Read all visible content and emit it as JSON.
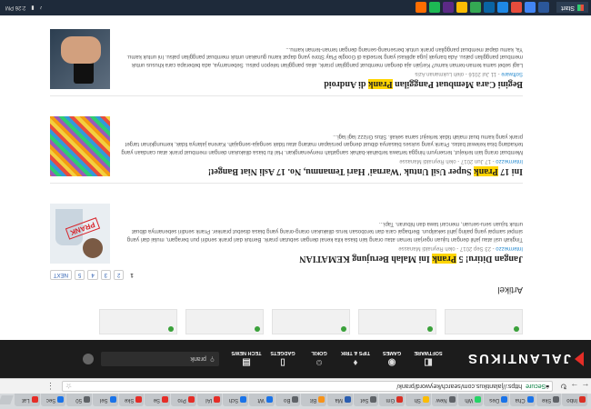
{
  "browser": {
    "tabs": [
      {
        "label": "Inbo",
        "color": "#d93025"
      },
      {
        "label": "Ske",
        "color": "#5f6368"
      },
      {
        "label": "Cha",
        "color": "#1a73e8"
      },
      {
        "label": "Des",
        "color": "#1a73e8"
      },
      {
        "label": "Wh",
        "color": "#25d366"
      },
      {
        "label": "New",
        "color": "#5f6368"
      },
      {
        "label": "Sh",
        "color": "#fbbc04"
      },
      {
        "label": "Gm",
        "color": "#d93025"
      },
      {
        "label": "Set",
        "color": "#5f6368"
      },
      {
        "label": "Ma",
        "color": "#2a5db0"
      },
      {
        "label": "Bit",
        "color": "#f7931a"
      },
      {
        "label": "Bo",
        "color": "#5f6368"
      },
      {
        "label": "Wt",
        "color": "#1a73e8"
      },
      {
        "label": "Sch",
        "color": "#1a73e8"
      },
      {
        "label": "IAI",
        "color": "#e52d27"
      },
      {
        "label": "Pro",
        "color": "#e52d27"
      },
      {
        "label": "Se",
        "color": "#e52d27"
      },
      {
        "label": "Ske",
        "color": "#e52d27"
      },
      {
        "label": "Sel",
        "color": "#1a73e8"
      },
      {
        "label": "50",
        "color": "#5f6368"
      },
      {
        "label": "Sec",
        "color": "#1a73e8"
      },
      {
        "label": "Lat",
        "color": "#e52d27"
      }
    ],
    "secure_label": "Secure",
    "url": "https://jalantikus.com/search/keyword/prank/"
  },
  "site": {
    "logo_text": "JALANTIKUS",
    "categories": [
      {
        "label": "SOFTWARE",
        "icon": "◧"
      },
      {
        "label": "GAMES",
        "icon": "◉"
      },
      {
        "label": "TIPS & TRIK",
        "icon": "♦"
      },
      {
        "label": "GOKIL",
        "icon": "☺"
      },
      {
        "label": "GADGETS",
        "icon": "▯"
      },
      {
        "label": "TECH NEWS",
        "icon": "▤"
      }
    ],
    "search_value": "prank"
  },
  "main": {
    "section_title": "Artikel",
    "pages": [
      "1",
      "2",
      "3",
      "4",
      "5",
      "NEXT"
    ],
    "articles": [
      {
        "title_before": "Jangan Ditiru! 5 ",
        "title_highlight": "Prank",
        "title_after": " Ini Malah Berujung KEMATIAN",
        "source": "Intermezzo",
        "meta": " - 23 Sep 2017 - oleh Reynaldi Manasse",
        "excerpt": "Tingkah usil atau jahil dengan tujuan ngerjain teman atau orang lain biasa kita kenal dengan sebutan prank. Bentuk dari prank sendiri pun beragam, mulai dari yang simpel sampai yang paling jahil sekalipun. Berbagai cara dan terobosan terus dilakukan orang-orang yang biasa disebut pranker. Prank sendiri sebenarnya dibuat untuk tujuan seru-seruan, mencari tawa dan hiburan. Tapi..."
      },
      {
        "title_before": "Ini 17 ",
        "title_highlight": "Prank",
        "title_after": " Super Usil Untuk 'Warnai' Hari Temanmu, No. 17 Asli Niat Banget!",
        "source": "Intermezzo",
        "meta": " - 17 Jun 2017 - oleh Reynaldi Manasse",
        "excerpt": "Membuat orang lain terkejut, tersenyum hingga tertawa terbahak-bahak sangatlah menyenangkan. Hal itu biasa dilakukan dengan membuat prank atau candaan yang terkadang bisa kelewat batas. Prank yang sukses biasanya dibuat dengan persiapan matang atau tidak sengaja-sengajah. Karena jalanya tidak, kemungkinan target prank yang kamu buat malah tidak terkejut sama sekali. Situs Grizzz lagi lagi..."
      },
      {
        "title_before": "Begini Cara Membuat Panggilan ",
        "title_highlight": "Prank",
        "title_after": " di Android",
        "source": "Software",
        "meta": " - 11 Jul 2016 - oleh Lukmanan Azis",
        "excerpt": "Lagi sebel sama teman-teman kamu? Kerjain aja dengan membuat panggilan prank, alias panggilan telepon palsu. Sebenarnya, ada beberapa cara khusus untuk membuat panggilan palsu. Ada banyak juga aplikasi yang tersedia di Google Play Store yang dapat kamu gunakan untuk membuat panggilan palsu. Ini untuk kamu. Ya, kamu dapat membuat panggilan prank untuk bersenang-senang dengan teman-teman kamu..."
      }
    ],
    "prank_stamp": "PRANK"
  },
  "taskbar": {
    "start_label": "Start",
    "time": "2:26 PM",
    "apps": [
      "#2b579a",
      "#4285f4",
      "#e74c3c",
      "#1e88e5",
      "#0a64a4",
      "#34a853",
      "#fbbc04",
      "#5b2a86",
      "#1db954",
      "#ff6d00"
    ]
  }
}
